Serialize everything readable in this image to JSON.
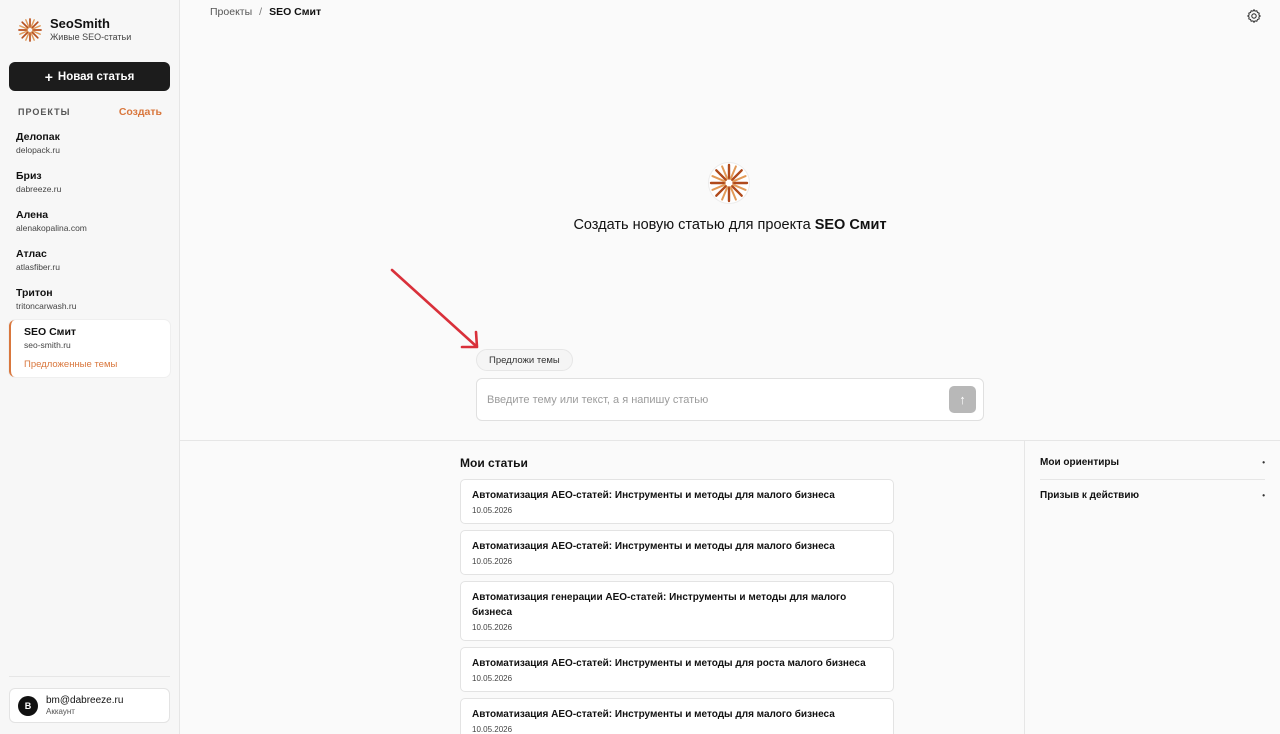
{
  "brand": {
    "name": "SeoSmith",
    "subtitle": "Живые SEO-статьи"
  },
  "sidebar": {
    "new_article_label": "Новая статья",
    "projects_title": "ПРОЕКТЫ",
    "create_label": "Создать",
    "projects": [
      {
        "name": "Делопак",
        "domain": "delopack.ru"
      },
      {
        "name": "Бриз",
        "domain": "dabreeze.ru"
      },
      {
        "name": "Алена",
        "domain": "alenakopalina.com"
      },
      {
        "name": "Атлас",
        "domain": "atlasfiber.ru"
      },
      {
        "name": "Тритон",
        "domain": "tritoncarwash.ru"
      }
    ],
    "active_project": {
      "name": "SEO Смит",
      "domain": "seo-smith.ru",
      "sub_link": "Предложенные темы"
    },
    "account": {
      "initial": "B",
      "email": "bm@dabreeze.ru",
      "label": "Аккаунт"
    }
  },
  "breadcrumb": {
    "parent": "Проекты",
    "separator": "/",
    "current": "SEO Смит"
  },
  "hero": {
    "title_prefix": "Создать новую статью для проекта",
    "project": "SEO Смит"
  },
  "composer": {
    "suggest_label": "Предложи темы",
    "placeholder": "Введите тему или текст, а я напишу статью",
    "send_icon": "↑"
  },
  "articles": {
    "title": "Мои статьи",
    "items": [
      {
        "title": "Автоматизация AEO-статей: Инструменты и методы для малого бизнеса",
        "date": "10.05.2026"
      },
      {
        "title": "Автоматизация AEO-статей: Инструменты и методы для малого бизнеса",
        "date": "10.05.2026"
      },
      {
        "title": "Автоматизация генерации AEO-статей: Инструменты и методы для малого бизнеса",
        "date": "10.05.2026"
      },
      {
        "title": "Автоматизация AEO-статей: Инструменты и методы для роста малого бизнеса",
        "date": "10.05.2026"
      },
      {
        "title": "Автоматизация AEO-статей: Инструменты и методы для малого бизнеса",
        "date": "10.05.2026"
      }
    ]
  },
  "right_panel": {
    "items": [
      {
        "label": "Мои ориентиры",
        "marker": "•"
      },
      {
        "label": "Призыв к действию",
        "marker": "•"
      }
    ]
  },
  "colors": {
    "accent": "#d9773d",
    "dark": "#1c1c1c",
    "arrow": "#d9303a"
  }
}
